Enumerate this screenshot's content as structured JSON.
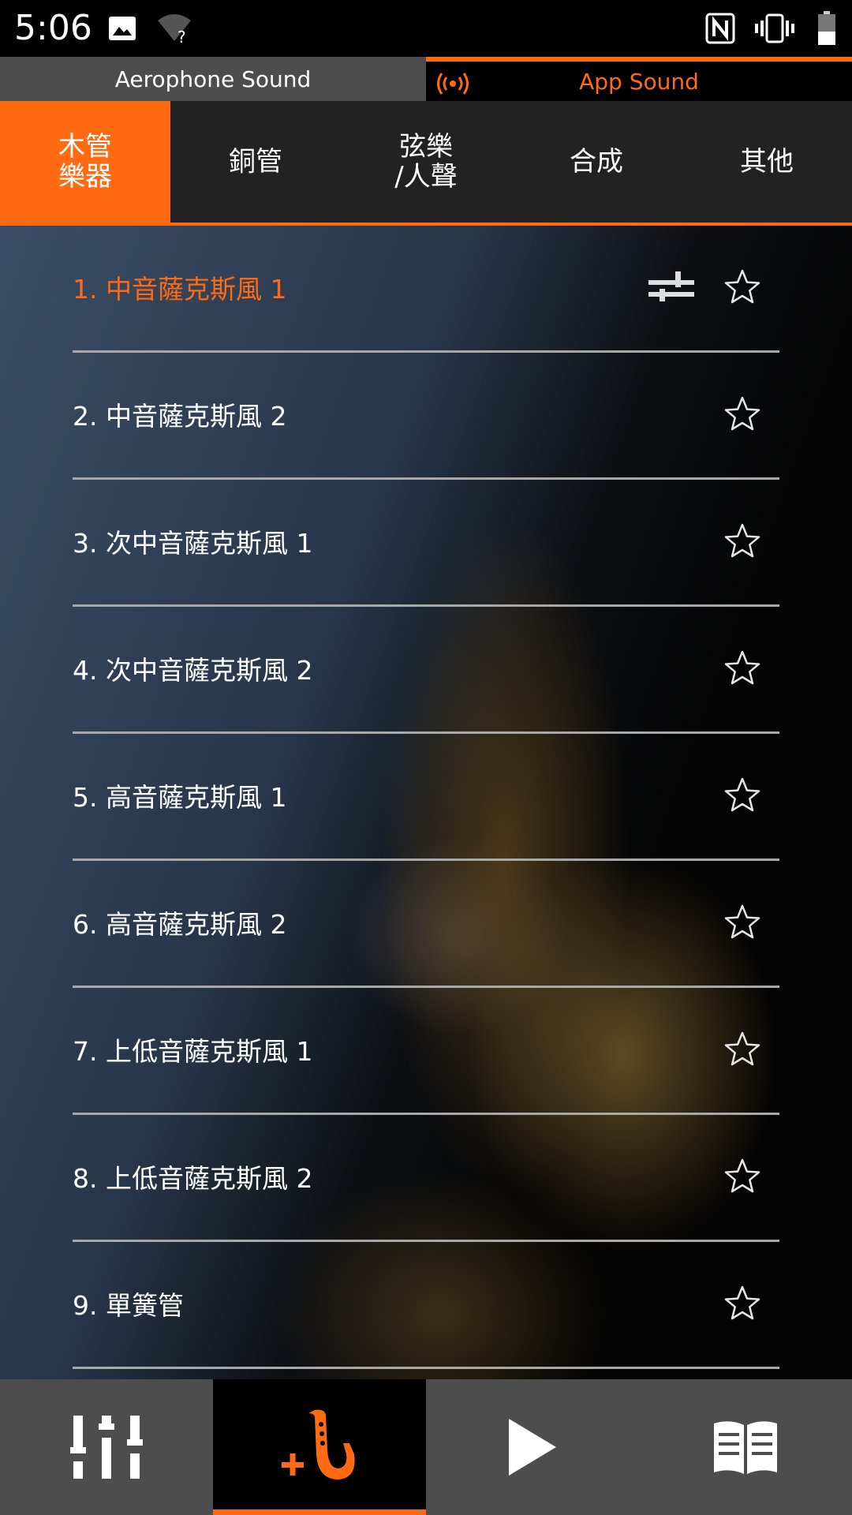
{
  "status_bar": {
    "time": "5:06",
    "icons": [
      "image-icon",
      "wifi-unknown-icon",
      "nfc-icon",
      "vibrate-icon",
      "battery-icon"
    ],
    "wifi_unknown_mark": "?"
  },
  "sound_source": {
    "tabs": [
      {
        "label": "Aerophone Sound",
        "active": false
      },
      {
        "label": "App Sound",
        "active": true,
        "icon": "broadcast-icon"
      }
    ]
  },
  "categories": {
    "tabs": [
      {
        "label": "木管\n樂器",
        "active": true
      },
      {
        "label": "銅管",
        "active": false
      },
      {
        "label": "弦樂\n∕人聲",
        "active": false
      },
      {
        "label": "合成",
        "active": false
      },
      {
        "label": "其他",
        "active": false
      }
    ]
  },
  "sound_list": {
    "items": [
      {
        "label": "1. 中音薩克斯風 1",
        "selected": true,
        "has_edit": true,
        "favorite": false
      },
      {
        "label": "2. 中音薩克斯風 2",
        "selected": false,
        "favorite": false
      },
      {
        "label": "3. 次中音薩克斯風 1",
        "selected": false,
        "favorite": false
      },
      {
        "label": "4. 次中音薩克斯風 2",
        "selected": false,
        "favorite": false
      },
      {
        "label": "5. 高音薩克斯風 1",
        "selected": false,
        "favorite": false
      },
      {
        "label": "6. 高音薩克斯風 2",
        "selected": false,
        "favorite": false
      },
      {
        "label": "7. 上低音薩克斯風 1",
        "selected": false,
        "favorite": false
      },
      {
        "label": "8. 上低音薩克斯風 2",
        "selected": false,
        "favorite": false
      },
      {
        "label": "9. 單簧管",
        "selected": false,
        "favorite": false
      }
    ]
  },
  "bottom_nav": {
    "items": [
      {
        "icon": "mixer-sliders-icon",
        "active": false
      },
      {
        "icon": "saxophone-add-icon",
        "active": true
      },
      {
        "icon": "play-icon",
        "active": false
      },
      {
        "icon": "book-icon",
        "active": false
      }
    ]
  },
  "colors": {
    "accent": "#ff6a13",
    "tab_bar_bg": "#222222",
    "nav_bg": "#4d4d4d",
    "divider": "#a8a8a8"
  }
}
